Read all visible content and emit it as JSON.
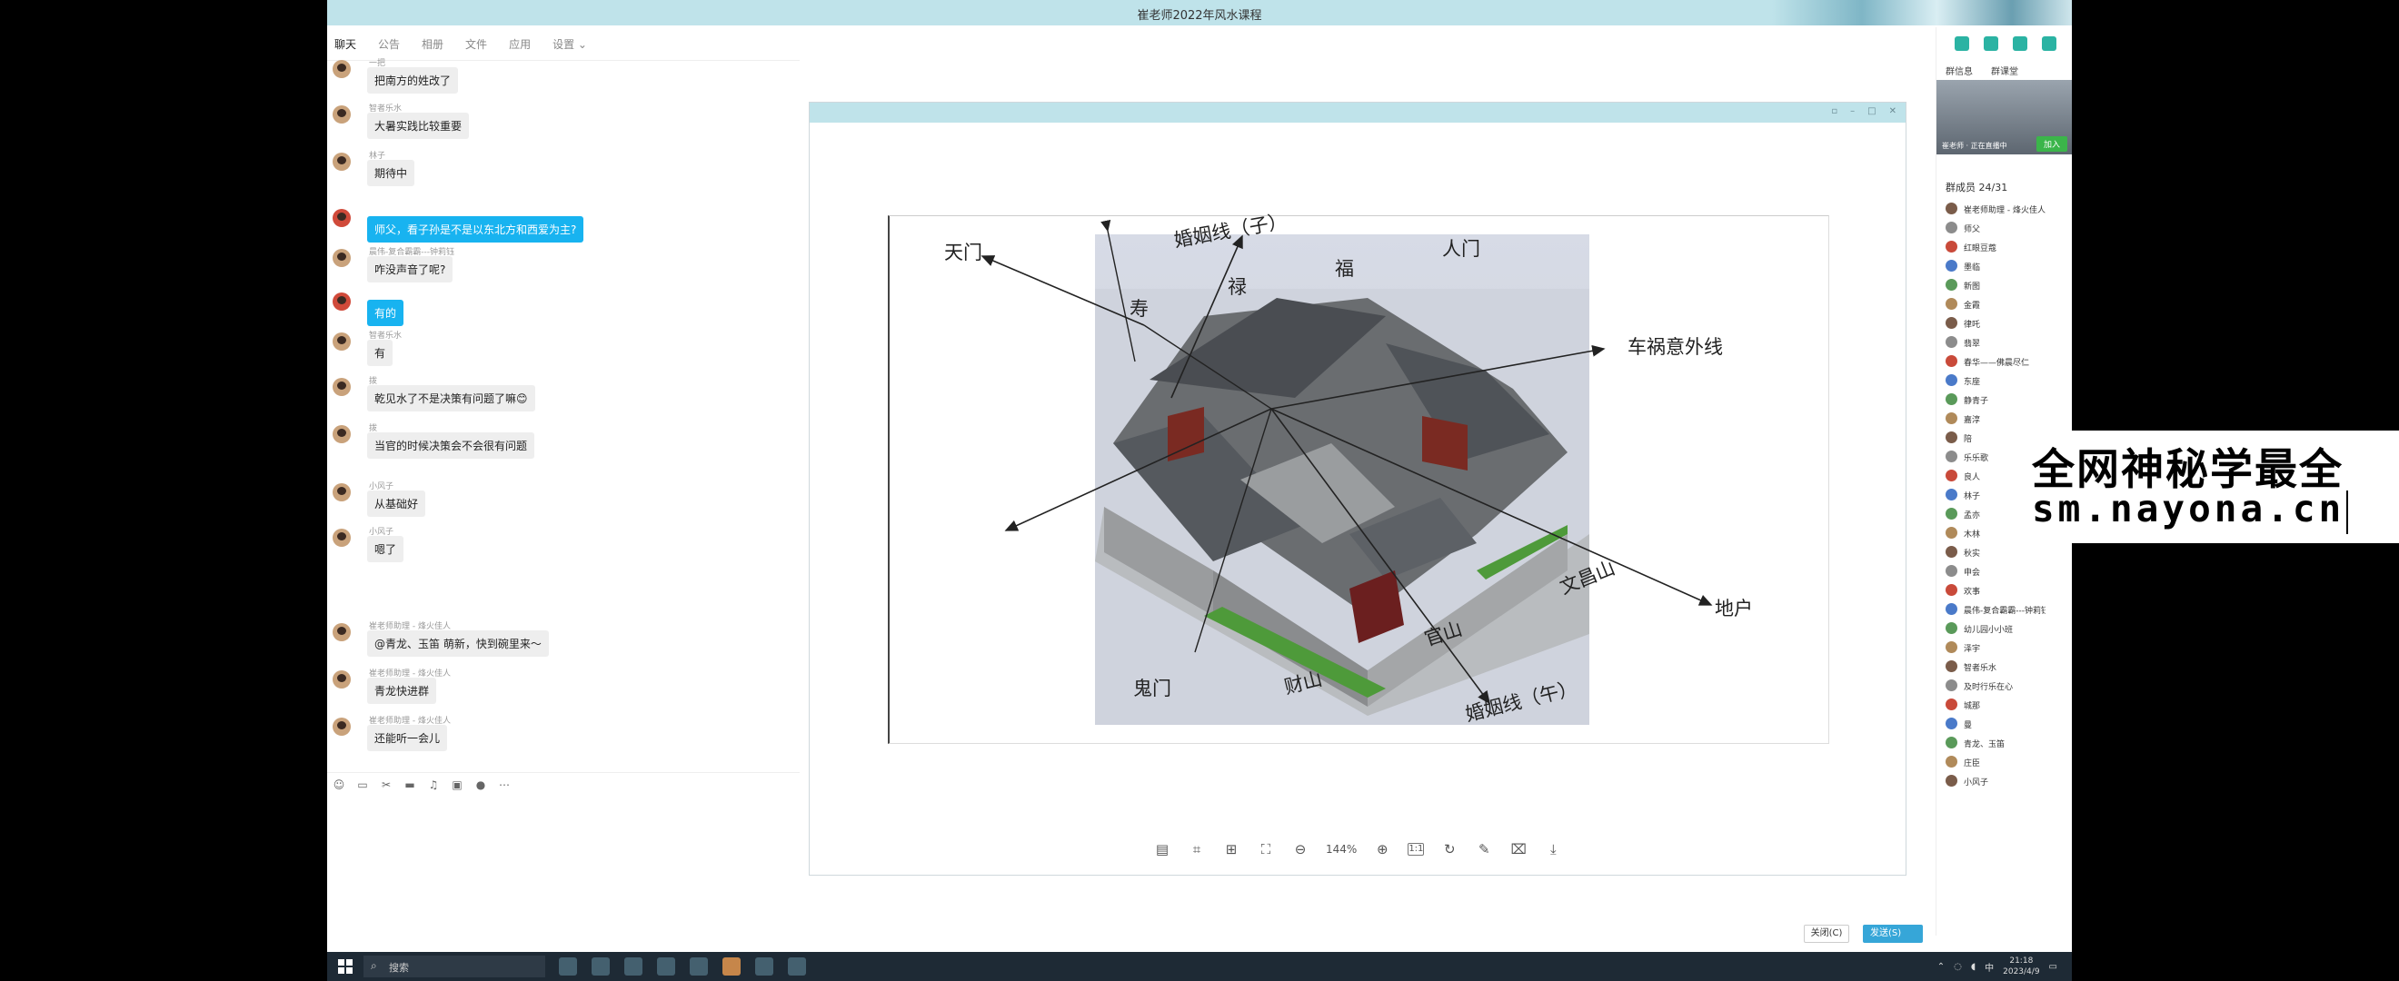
{
  "window": {
    "title": "崔老师2022年风水课程"
  },
  "chat_tabs": [
    "聊天",
    "公告",
    "相册",
    "文件",
    "应用",
    "设置 ⌄"
  ],
  "messages": [
    {
      "name": "一把",
      "text": "把南方的姓改了",
      "mine": false
    },
    {
      "name": "智者乐水",
      "text": "大暑实践比较重要",
      "mine": false
    },
    {
      "name": "林子",
      "text": "期待中",
      "mine": false
    },
    {
      "name": "",
      "text": "师父，看子孙是不是以东北方和西爱为主?",
      "mine": true
    },
    {
      "name": "晨伟-复合霸霸---钟莉钰",
      "text": "咋没声音了呢?",
      "mine": false
    },
    {
      "name": "",
      "text": "有的",
      "mine": true
    },
    {
      "name": "智者乐水",
      "text": "有",
      "mine": false
    },
    {
      "name": "拨",
      "text": "乾见水了不是决策有问题了嘛😊",
      "mine": false
    },
    {
      "name": "拨",
      "text": "当官的时候决策会不会很有问题",
      "mine": false
    },
    {
      "name": "小风子",
      "text": "从基础好",
      "mine": false
    },
    {
      "name": "小风子",
      "text": "嗯了",
      "mine": false
    },
    {
      "name": "崔老师助理 - 烽火佳人",
      "text": "@青龙、玉笛 萌新，快到碗里来～",
      "mine": false
    },
    {
      "name": "崔老师助理 - 烽火佳人",
      "text": "青龙快进群",
      "mine": false
    },
    {
      "name": "崔老师助理 - 烽火佳人",
      "text": "还能听一会儿",
      "mine": false
    }
  ],
  "diagram": {
    "labels": {
      "tianmen": "天门",
      "hunyin_zi": "婚姻线（子）",
      "shou": "寿",
      "lu": "禄",
      "fu": "福",
      "renmen": "人门",
      "chehuo": "车祸意外线",
      "dihu": "地户",
      "wenchangshan": "文昌山",
      "guanshan": "官山",
      "caishan": "财山",
      "guimen": "鬼门",
      "hunyin_wu": "婚姻线（午）"
    }
  },
  "viewer": {
    "zoom": "144%",
    "ratio_label": "1:1"
  },
  "right_panel": {
    "tabs": [
      "群信息",
      "群课堂"
    ],
    "preview_text": "崔老师 · 正在直播中",
    "join_label": "加入",
    "member_count": "群成员 24/31",
    "members": [
      "崔老师助理 - 烽火佳人",
      "师父",
      "红眼豆蔻",
      "墨临",
      "新图",
      "金霞",
      "律吒",
      "翡翠",
      "春华——佛晨尽仁",
      "东座",
      "静青子",
      "嘉淳",
      "陪",
      "乐乐歌",
      "良人",
      "林子",
      "孟亦",
      "木林",
      "秋实",
      "申会",
      "欢事",
      "晨伟-复合霸霸---钟莉钰",
      "幼儿园小小班",
      "泽宇",
      "智者乐水",
      "及时行乐在心",
      "城那",
      "曼",
      "青龙、玉笛",
      "庄臣",
      "小风子"
    ]
  },
  "buttons": {
    "close": "关闭(C)",
    "send": "发送(S)"
  },
  "taskbar": {
    "search": "搜索",
    "time": "21:18",
    "date": "2023/4/9",
    "ime": "中"
  },
  "watermark": {
    "line1": "全网神秘学最全",
    "line2": "sm.nayona.cn"
  }
}
